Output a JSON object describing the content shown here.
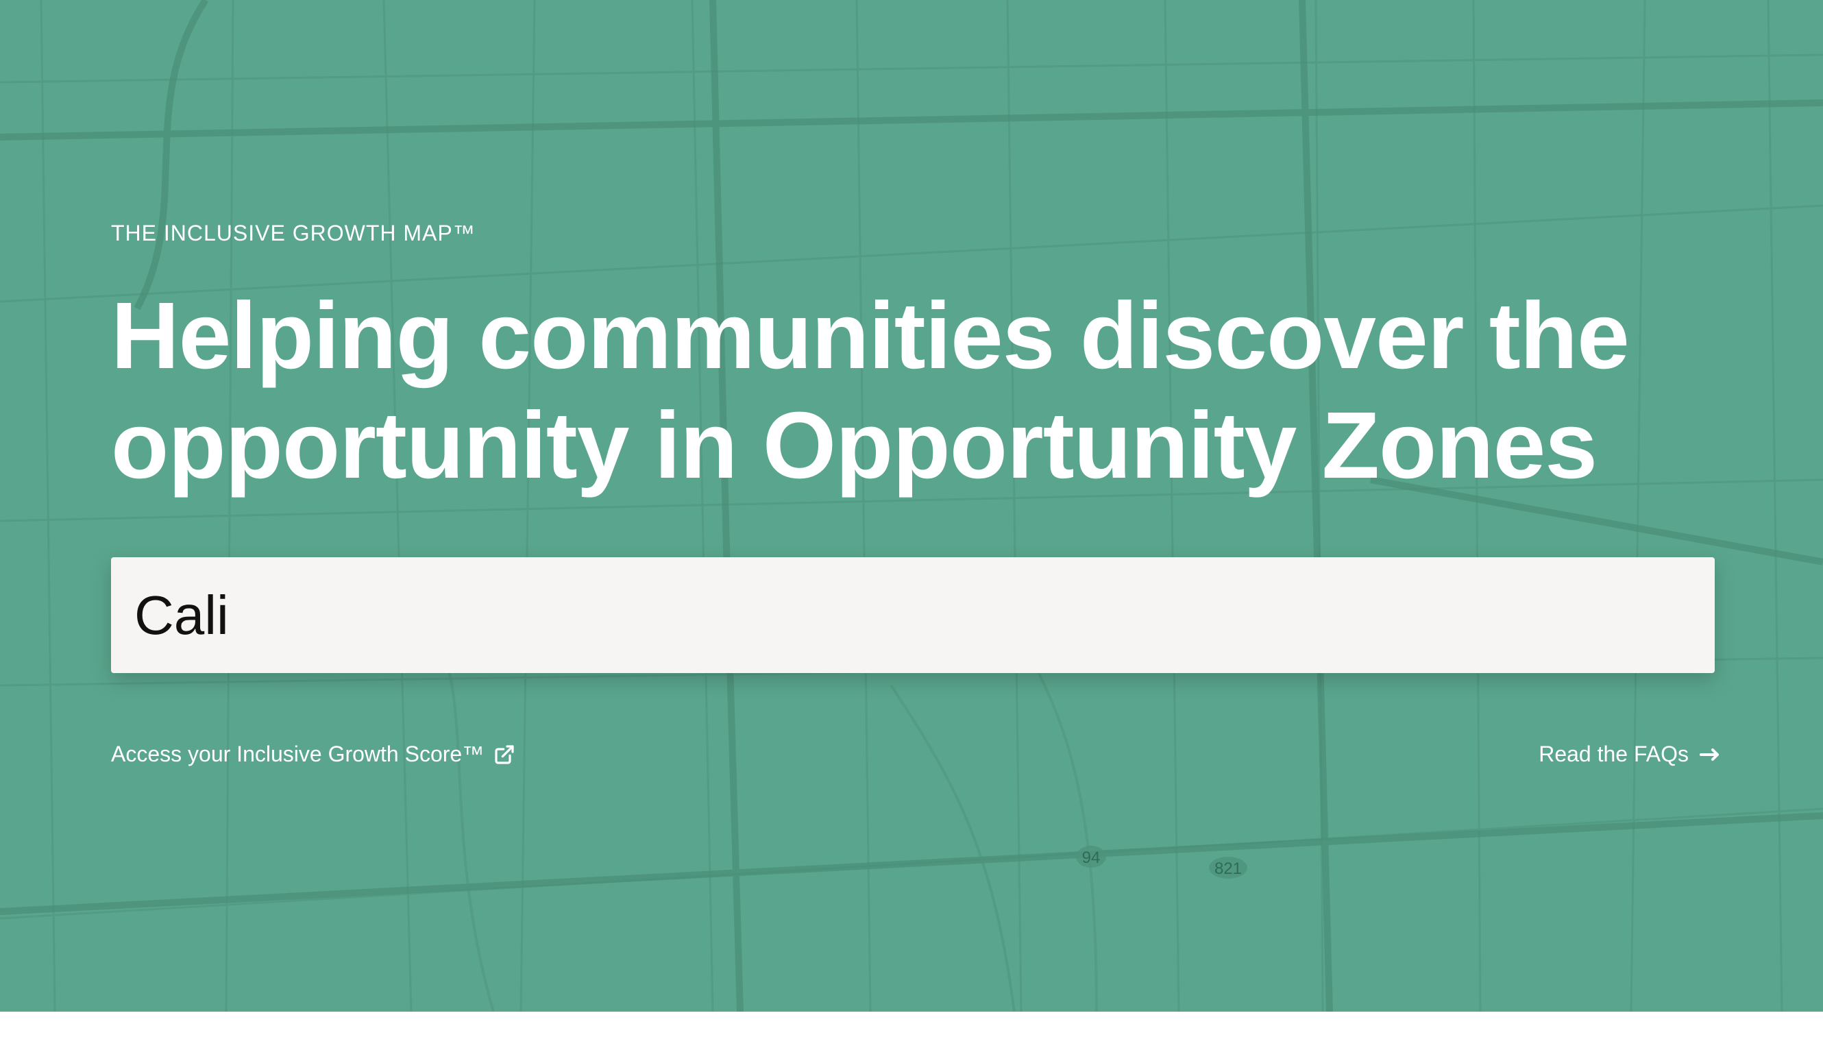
{
  "hero": {
    "eyebrow": "THE INCLUSIVE GROWTH MAP™",
    "headline_line1": "Helping communities discover the",
    "headline_line2": "opportunity in Opportunity Zones",
    "background_color": "#5aa58d"
  },
  "search": {
    "value": "Cali"
  },
  "links": {
    "score_label": "Access your Inclusive Growth Score™",
    "score_icon": "external-link-icon",
    "faq_label": "Read the FAQs",
    "faq_icon": "arrow-right-icon"
  },
  "map_labels": {
    "route_94": "94",
    "route_821": "821"
  }
}
